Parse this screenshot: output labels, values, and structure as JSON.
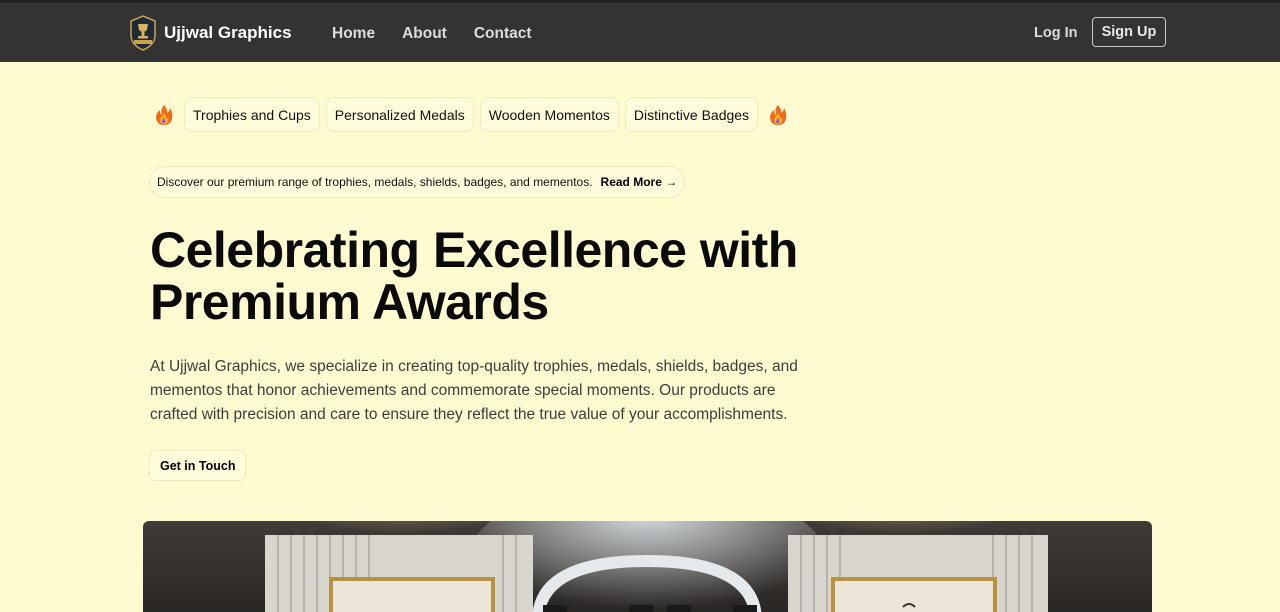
{
  "brand": {
    "name": "Ujjwal Graphics",
    "logo_icon": "trophy-emblem-icon"
  },
  "nav": {
    "links": [
      "Home",
      "About",
      "Contact"
    ],
    "login": "Log In",
    "signup": "Sign Up"
  },
  "categories": [
    "Trophies and Cups",
    "Personalized Medals",
    "Wooden Momentos",
    "Distinctive Badges"
  ],
  "decor_icon": "fire-icon",
  "announcement": {
    "text": "Discover our premium range of trophies, medals, shields, badges, and mementos.",
    "link": "Read More →"
  },
  "hero": {
    "headline": "Celebrating Excellence with Premium Awards",
    "description": "At Ujjwal Graphics, we specialize in creating top-quality trophies, medals, shields, badges, and mementos that honor achievements and commemorate special moments. Our products are crafted with precision and care to ensure they reflect the true value of your accomplishments.",
    "cta": "Get in Touch"
  },
  "colors": {
    "nav_bg": "#333333",
    "page_bg": "#fffbd0"
  }
}
